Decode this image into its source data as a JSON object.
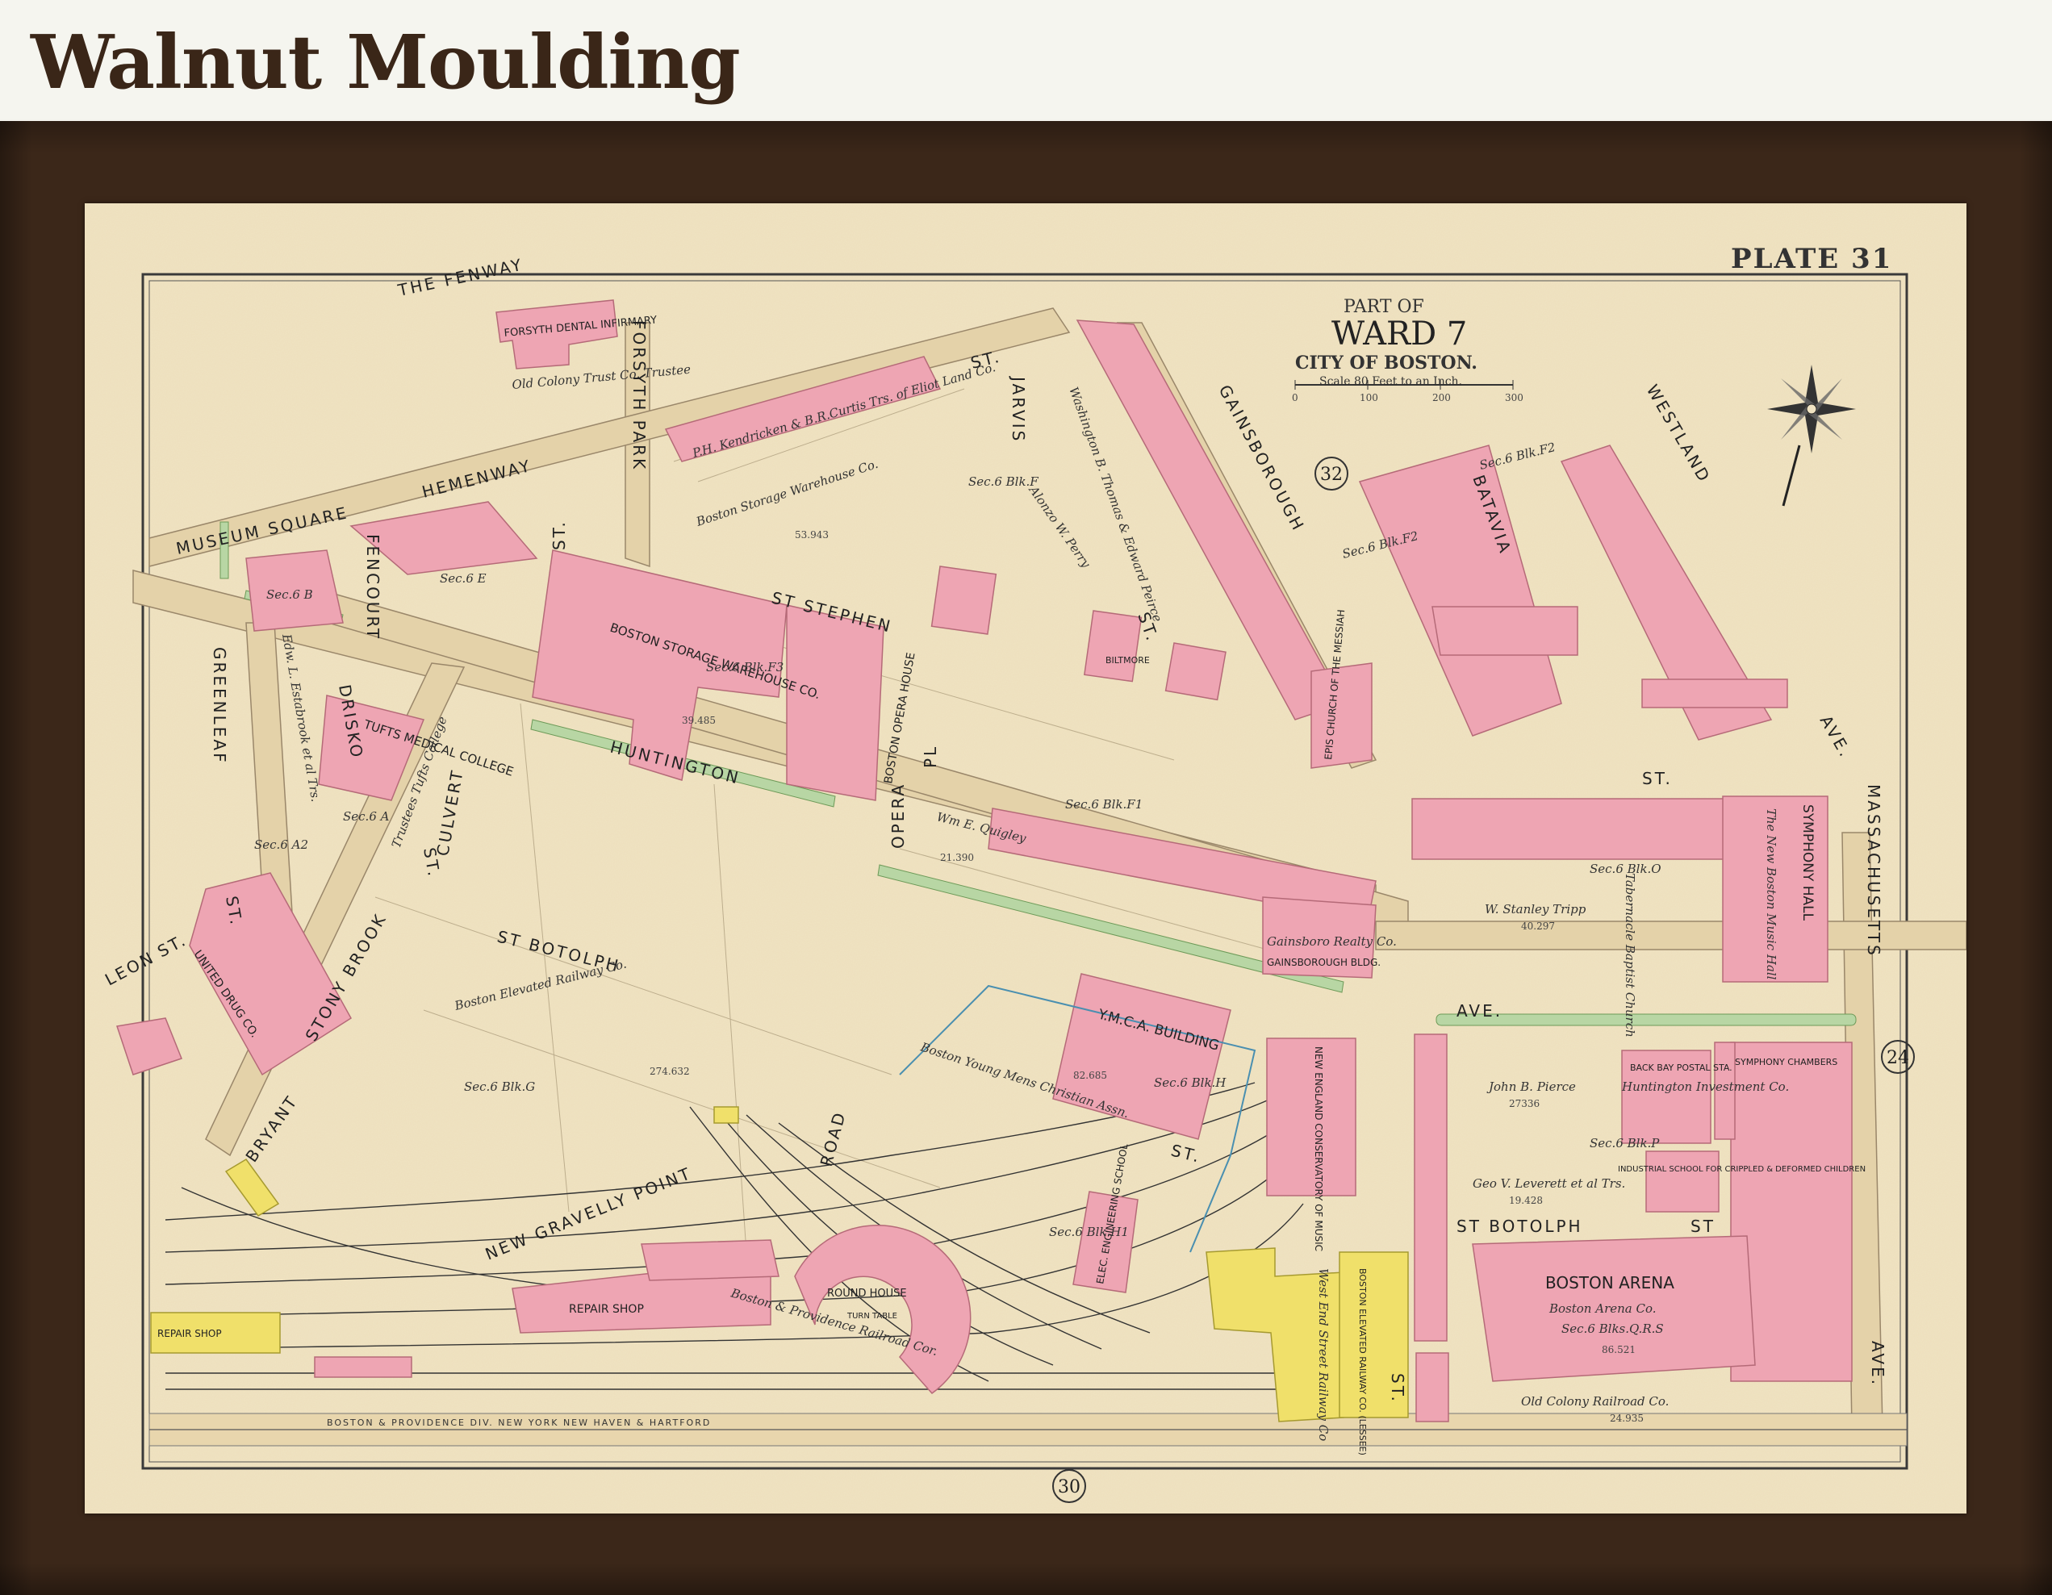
{
  "header": {
    "title": "Walnut Moulding"
  },
  "map": {
    "plate": "PLATE 31",
    "title_part": "PART OF",
    "title_ward": "WARD 7",
    "title_city": "CITY OF BOSTON.",
    "scale_text": "Scale 80 Feet to an Inch.",
    "scale_ticks": [
      "0",
      "100",
      "200",
      "300"
    ],
    "ward_circle": "32",
    "adjacent_plates": {
      "right": "24",
      "bottom": "30"
    },
    "streets": {
      "fenway": "THE FENWAY",
      "forsyth": "FORSYTH  PARK",
      "hemenway": "HEMENWAY",
      "museum": "MUSEUM SQUARE",
      "fencourt": "FENCOURT",
      "st1": "ST.",
      "st_stephen": "ST STEPHEN",
      "st_top": "ST.",
      "jarvis": "JARVIS",
      "gainsborough": "GAINSBOROUGH",
      "batavia": "BATAVIA",
      "westland": "WESTLAND",
      "ave_right": "AVE.",
      "greenleaf": "GREENLEAF",
      "drisko": "DRISKO",
      "drisko_st": "ST.",
      "huntington": "HUNTINGTON",
      "opera": "OPERA",
      "pl": "PL",
      "st_mid": "ST.",
      "st_gains_end": "ST.",
      "massachusetts": "MASSACHUSETTS",
      "leon": "LEON",
      "leon_st": "ST.",
      "st_leon": "ST.",
      "st_botolph": "ST BOTOLPH",
      "bryant": "BRYANT",
      "stony_brook": "STONY BROOK",
      "culvert": "CULVERT",
      "road": "ROAD",
      "new_gravelly": "NEW GRAVELLY POINT",
      "ave_huntington": "AVE.",
      "st_botolph_right": "ST BOTOLPH",
      "st_botolph_r_st": "ST",
      "st_right_lower": "ST.",
      "st_ymca": "ST.",
      "ave_mass": "AVE.",
      "railroad_bottom": "BOSTON   &   PROVIDENCE   DIV.   NEW YORK   NEW HAVEN   &   HARTFORD"
    },
    "buildings": {
      "forsyth_dental": "FORSYTH DENTAL INFIRMARY",
      "old_colony_trust": "Old Colony Trust Co. Trustee",
      "boston_storage": "BOSTON STORAGE WAREHOUSE CO.",
      "boston_storage_owner": "Boston Storage Warehouse Co.",
      "opera_house": "BOSTON OPERA HOUSE",
      "tufts": "TUFTS MEDICAL COLLEGE",
      "trustees_tufts": "Trustees Tufts College",
      "epis_church": "EPIS CHURCH OF THE MESSIAH",
      "symphony_hall": "SYMPHONY HALL",
      "new_boston_music_hall": "The New Boston Music Hall",
      "ymca": "Y.M.C.A. BUILDING",
      "ymca_owner": "Boston Young Mens Christian Assn.",
      "conservatory": "NEW ENGLAND CONSERVATORY OF MUSIC",
      "elec_eng": "ELEC. ENGINEERING SCHOOL",
      "boston_arena": "BOSTON ARENA",
      "boston_arena_owner": "Boston Arena Co.",
      "industrial_school": "INDUSTRIAL SCHOOL FOR CRIPPLED & DEFORMED CHILDREN",
      "back_bay_postal": "BACK BAY POSTAL STA.",
      "huntington_investment": "Huntington Investment Co.",
      "symphony_chambers": "SYMPHONY CHAMBERS",
      "repair_shop": "REPAIR SHOP",
      "repair_shop_left": "REPAIR SHOP",
      "round_house": "ROUND HOUSE",
      "turn_table": "TURN TABLE",
      "united_drug": "UNITED DRUG CO.",
      "gainsborough_bldg": "GAINSBOROUGH BLDG.",
      "boston_elevated_leased": "BOSTON ELEVATED RAILWAY CO. (LESSEE)",
      "west_end_street": "West End Street Railway Co",
      "biltmore": "BILTMORE",
      "tuberculosis": "Tabernacle Baptist Church"
    },
    "owners": {
      "boston_elevated": "Boston Elevated Railway Co.",
      "boston_providence": "Boston & Providence Railroad Cor.",
      "old_colony_rr": "Old Colony Railroad Co.",
      "stanley_tripp": "W. Stanley Tripp",
      "john_pierce": "John B. Pierce",
      "geo_leverett": "Geo V. Leverett et al Trs.",
      "wm_quigley": "Wm E. Quigley",
      "edw_eslabrook": "Edw. L. Estabrook et al Trs.",
      "gainsborough_realty": "Gainsboro Realty Co.",
      "alonzo_perry": "Alonzo W. Perry",
      "wash_thomas": "Washington B. Thomas & Edward Peirce",
      "kendricken": "P.H. Kendricken & B.R.Curtis Trs. of Eliot Land Co."
    },
    "sections": {
      "sec6f": "Sec.6 Blk.F",
      "sec6f3": "Sec.6 Blk.F3",
      "sec6f1": "Sec.6 Blk.F1",
      "sec6g": "Sec.6 Blk.G",
      "sec6h": "Sec.6 Blk.H",
      "sec6h1": "Sec.6 Blk.H1",
      "sec6o": "Sec.6 Blk.O",
      "sec6p": "Sec.6 Blk.P",
      "sec6qrs": "Sec.6 Blks.Q.R.S",
      "sec6a": "Sec.6 A",
      "sec6a2": "Sec.6 A2",
      "sec6b": "Sec.6 B",
      "sec6e": "Sec.6 E",
      "sec6f2a": "Sec.6 Blk.F2",
      "sec6f2b": "Sec.6 Blk.F2"
    },
    "areas": {
      "boston_storage_area": "53.943",
      "storage_wh_area": "39.485",
      "elevated_area": "274.632",
      "tripp_area": "40.297",
      "pierce_area": "27336",
      "leverett_area": "19.428",
      "arena_area": "86.521",
      "old_colony_area": "24.935",
      "ymca_area": "82.685",
      "quigley_area": "21.390"
    },
    "colors": {
      "paper": "#f3e9cc",
      "building_pink": "#eea5b3",
      "building_yellow": "#f0e06a",
      "park_green": "#b8d6a4",
      "street_fill": "#ecdcb8",
      "frame_wood": "#3b2719"
    }
  }
}
